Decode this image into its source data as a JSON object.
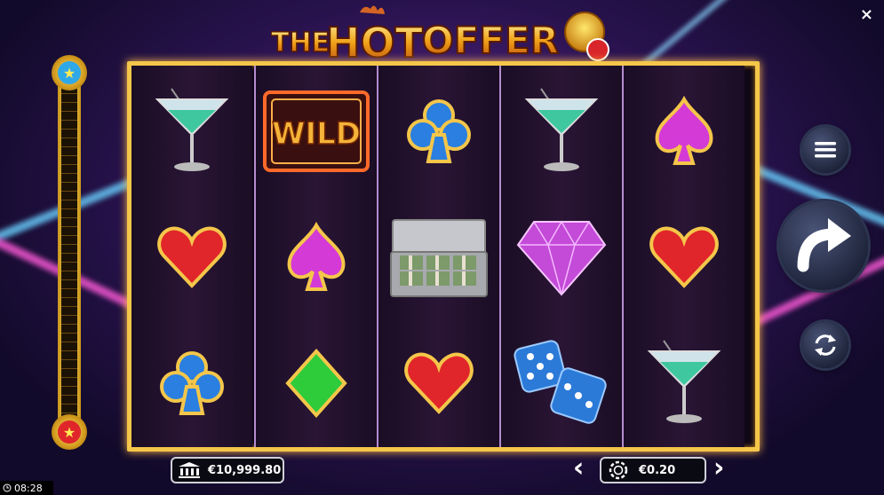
{
  "game": {
    "title_part1": "THE",
    "title_part2": "HOT",
    "title_part3": "OFFER",
    "close_label": "×"
  },
  "reels": [
    [
      "martini-glass",
      "heart",
      "club"
    ],
    [
      "wild",
      "spade-purple",
      "diamond-green"
    ],
    [
      "club",
      "money-briefcase",
      "heart"
    ],
    [
      "martini-glass",
      "gem-diamond",
      "dice"
    ],
    [
      "spade-purple",
      "heart",
      "martini-glass"
    ]
  ],
  "wild_label": "WILD",
  "balance": {
    "value": "€10,999.80",
    "icon": "bank-icon"
  },
  "bet": {
    "value": "€0.20",
    "icon": "chip-icon"
  },
  "clock": {
    "time": "08:28",
    "icon": "clock-icon"
  },
  "controls": [
    "menu-icon",
    "spin-icon",
    "autoplay-icon"
  ],
  "colors": {
    "gold": "#f4c64a",
    "frame_bg": "#0f0716",
    "heart": "#e0262a",
    "club": "#2a7fe0",
    "spade": "#d43ad6",
    "diamond_green": "#2ecc3a"
  }
}
